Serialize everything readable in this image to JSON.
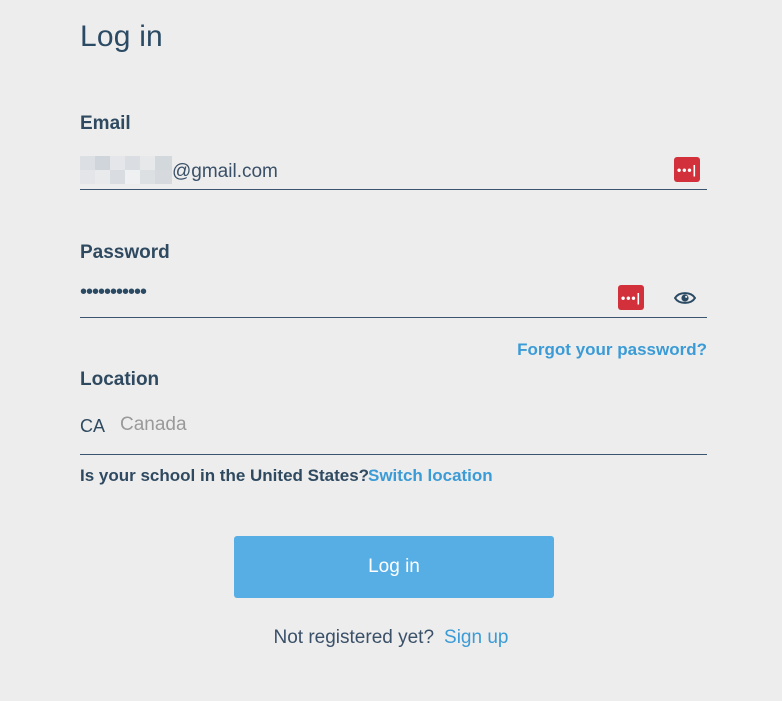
{
  "page": {
    "title": "Log in"
  },
  "form": {
    "email": {
      "label": "Email",
      "value_visible_suffix": "@gmail.com"
    },
    "password": {
      "label": "Password",
      "masked_value": "•••••••••••"
    },
    "forgot_password_link": "Forgot your password?",
    "location": {
      "label": "Location",
      "code": "CA",
      "placeholder": "Canada"
    },
    "us_question": "Is your school in the United States?",
    "switch_location_link": "Switch location",
    "submit_label": "Log in"
  },
  "footer": {
    "prompt": "Not registered yet?",
    "signup_link": "Sign up"
  },
  "icons": {
    "password_manager": "password-manager-icon",
    "show_password": "eye-icon"
  },
  "colors": {
    "primary_button": "#56aee5",
    "link": "#3a9bd6",
    "password_manager_red": "#d2303a",
    "text_dark": "#2b4a63",
    "background": "#ededed"
  }
}
